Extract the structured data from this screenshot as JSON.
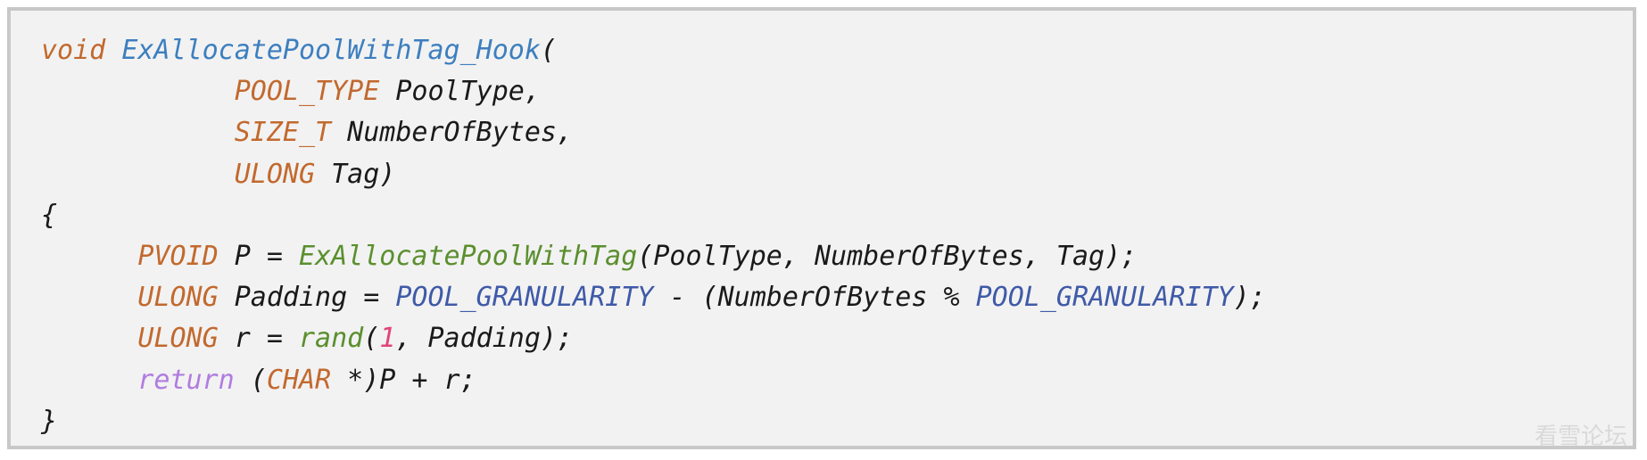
{
  "code": {
    "lines": [
      [
        {
          "text": "void",
          "kind": "type"
        },
        {
          "text": " ",
          "kind": "plain"
        },
        {
          "text": "ExAllocatePoolWithTag_Hook",
          "kind": "func-def"
        },
        {
          "text": "(",
          "kind": "plain"
        }
      ],
      [
        {
          "text": "            ",
          "kind": "plain"
        },
        {
          "text": "POOL_TYPE",
          "kind": "type"
        },
        {
          "text": " PoolType,",
          "kind": "plain"
        }
      ],
      [
        {
          "text": "            ",
          "kind": "plain"
        },
        {
          "text": "SIZE_T",
          "kind": "type"
        },
        {
          "text": " NumberOfBytes,",
          "kind": "plain"
        }
      ],
      [
        {
          "text": "            ",
          "kind": "plain"
        },
        {
          "text": "ULONG",
          "kind": "type"
        },
        {
          "text": " Tag)",
          "kind": "plain"
        }
      ],
      [
        {
          "text": "{",
          "kind": "plain"
        }
      ],
      [
        {
          "text": "      ",
          "kind": "plain"
        },
        {
          "text": "PVOID",
          "kind": "type"
        },
        {
          "text": " P = ",
          "kind": "plain"
        },
        {
          "text": "ExAllocatePoolWithTag",
          "kind": "func-call"
        },
        {
          "text": "(PoolType, NumberOfBytes, Tag);",
          "kind": "plain"
        }
      ],
      [
        {
          "text": "      ",
          "kind": "plain"
        },
        {
          "text": "ULONG",
          "kind": "type"
        },
        {
          "text": " Padding = ",
          "kind": "plain"
        },
        {
          "text": "POOL_GRANULARITY",
          "kind": "const"
        },
        {
          "text": " - (NumberOfBytes % ",
          "kind": "plain"
        },
        {
          "text": "POOL_GRANULARITY",
          "kind": "const"
        },
        {
          "text": ");",
          "kind": "plain"
        }
      ],
      [
        {
          "text": "      ",
          "kind": "plain"
        },
        {
          "text": "ULONG",
          "kind": "type"
        },
        {
          "text": " r = ",
          "kind": "plain"
        },
        {
          "text": "rand",
          "kind": "func-call"
        },
        {
          "text": "(",
          "kind": "plain"
        },
        {
          "text": "1",
          "kind": "num"
        },
        {
          "text": ", Padding);",
          "kind": "plain"
        }
      ],
      [
        {
          "text": "      ",
          "kind": "plain"
        },
        {
          "text": "return",
          "kind": "return"
        },
        {
          "text": " (",
          "kind": "plain"
        },
        {
          "text": "CHAR",
          "kind": "type"
        },
        {
          "text": " *)P + r;",
          "kind": "plain"
        }
      ],
      [
        {
          "text": "}",
          "kind": "plain"
        }
      ]
    ]
  },
  "colors": {
    "type": "#c2692e",
    "func_def": "#3d7fbf",
    "func_call": "#5b8f2e",
    "const": "#3f5aa8",
    "return": "#b07ce0",
    "num": "#e0447a",
    "background": "#f2f2f2",
    "border": "#c8c8c8"
  },
  "watermark": {
    "text": "看雪论坛"
  }
}
